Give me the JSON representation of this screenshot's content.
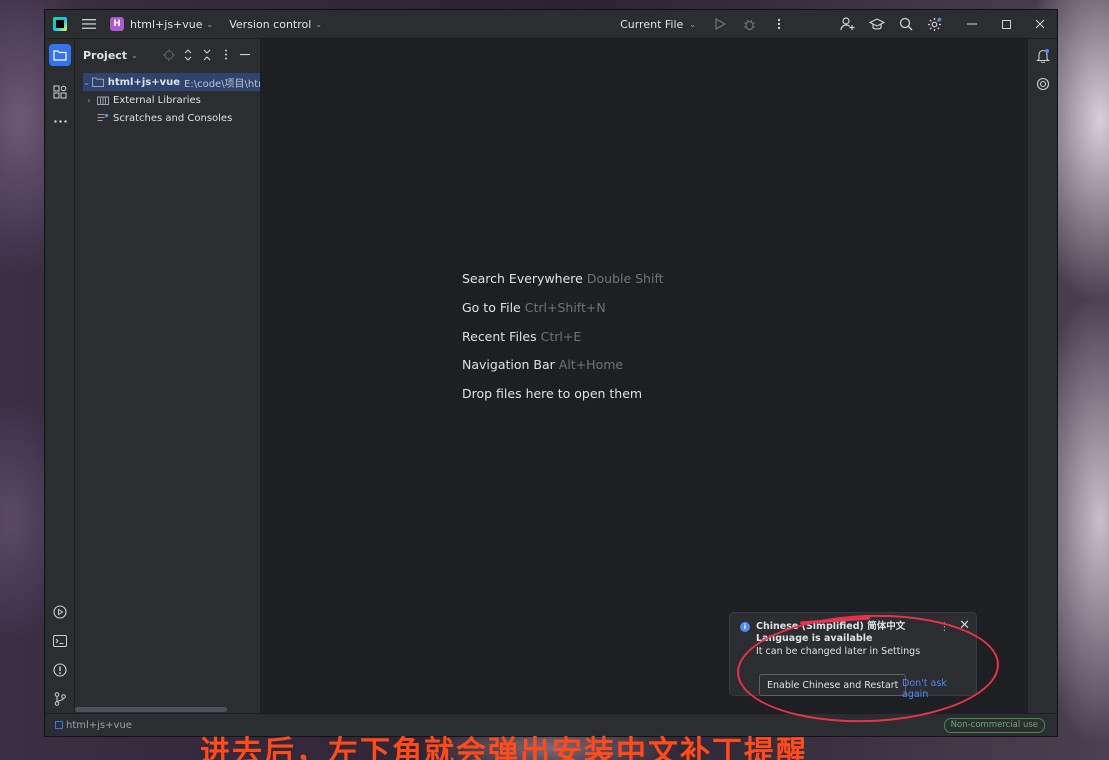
{
  "titlebar": {
    "project_badge": "H",
    "project_name": "html+js+vue",
    "version_control": "Version control",
    "run_config": "Current File"
  },
  "project_panel": {
    "title": "Project",
    "tree": [
      {
        "label": "html+js+vue",
        "path": "E:\\code\\项目\\html+j",
        "selected": true,
        "expanded": true
      },
      {
        "label": "External Libraries",
        "expanded": false
      },
      {
        "label": "Scratches and Consoles"
      }
    ]
  },
  "editor_hints": [
    {
      "action": "Search Everywhere",
      "shortcut": "Double Shift"
    },
    {
      "action": "Go to File",
      "shortcut": "Ctrl+Shift+N"
    },
    {
      "action": "Recent Files",
      "shortcut": "Ctrl+E"
    },
    {
      "action": "Navigation Bar",
      "shortcut": "Alt+Home"
    },
    {
      "action": "Drop files here to open them",
      "shortcut": ""
    }
  ],
  "notification": {
    "title": "Chinese (Simplified) 简体中文 Language is available",
    "body": "It can be changed later in Settings",
    "primary_action": "Enable Chinese and Restart",
    "secondary_action": "Don't ask again"
  },
  "statusbar": {
    "project": "html+js+vue",
    "license": "Non-commercial use"
  },
  "overlay_caption": "进去后，左下角就会弹出安装中文补丁提醒",
  "colors": {
    "accent": "#3574f0",
    "annotation": "#e8334c",
    "caption": "#ff4a1a",
    "badge": "#b15ad0"
  }
}
